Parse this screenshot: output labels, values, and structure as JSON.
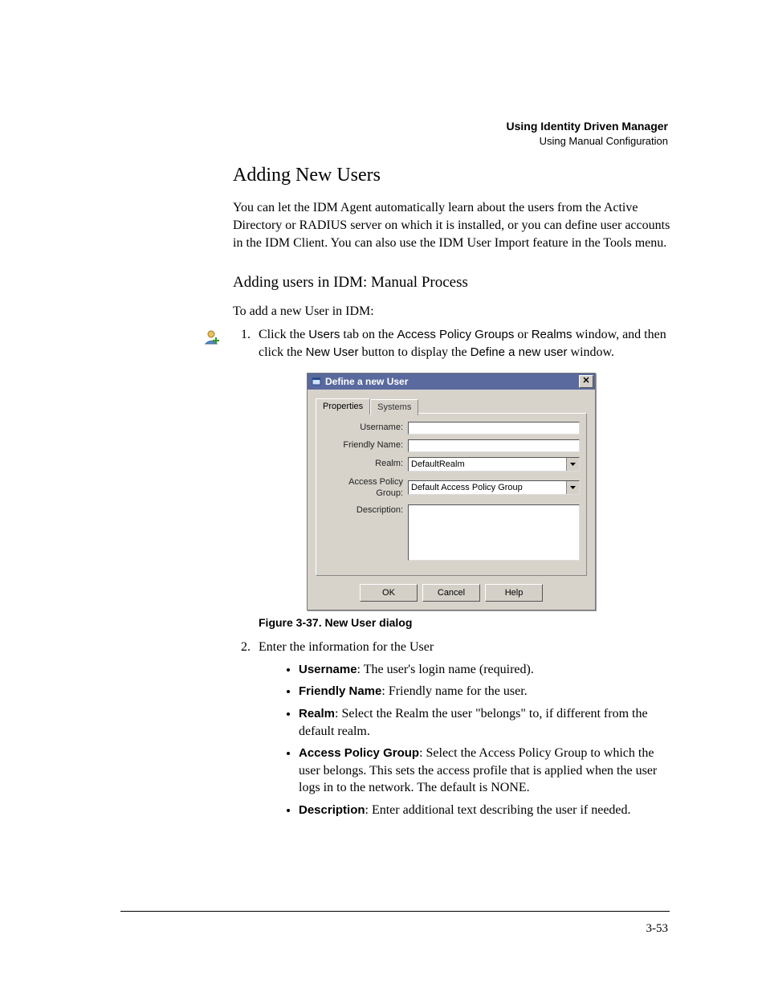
{
  "header": {
    "bold": "Using Identity Driven Manager",
    "sub": "Using Manual Configuration"
  },
  "section_title": "Adding New Users",
  "intro_para": "You can let the IDM Agent automatically learn about the users from the Active Directory or RADIUS server on which it is installed, or you can define user accounts in the IDM Client. You can also use the IDM User Import feature in the Tools menu.",
  "subsection_title": "Adding users in IDM: Manual Process",
  "lead_in": "To add a new User in IDM:",
  "steps": {
    "s1": {
      "pre1": "Click the ",
      "t1": "Users",
      "mid1": " tab on the ",
      "t2": "Access Policy Groups",
      "mid2": " or ",
      "t3": "Realms",
      "mid3": " window, and then click the ",
      "t4": "New User",
      "mid4": " button to display the ",
      "t5": "Define a new user",
      "post": " window."
    },
    "s2_text": "Enter the information for the User"
  },
  "dialog": {
    "title": "Define a new User",
    "tabs": {
      "properties": "Properties",
      "systems": "Systems"
    },
    "labels": {
      "username": "Username:",
      "friendly": "Friendly Name:",
      "realm": "Realm:",
      "apg": "Access Policy Group:",
      "description": "Description:"
    },
    "values": {
      "username": "",
      "friendly": "",
      "realm": "DefaultRealm",
      "apg": "Default Access Policy Group",
      "description": ""
    },
    "buttons": {
      "ok": "OK",
      "cancel": "Cancel",
      "help": "Help"
    }
  },
  "figure_caption": "Figure 3-37. New User dialog",
  "bullets": {
    "username": {
      "label": "Username",
      "text": ": The user's login name (required)."
    },
    "friendly": {
      "label": "Friendly Name",
      "text": ": Friendly name for the user."
    },
    "realm": {
      "label": "Realm",
      "text": ": Select the Realm the user \"belongs\" to, if different from the default realm."
    },
    "apg": {
      "label": "Access Policy Group",
      "text": ": Select the Access Policy Group to which the user belongs. This sets the access profile that is applied when the user logs in to the network. The default is NONE."
    },
    "description": {
      "label": "Description",
      "text": ": Enter additional text describing the user if needed."
    }
  },
  "page_number": "3-53"
}
